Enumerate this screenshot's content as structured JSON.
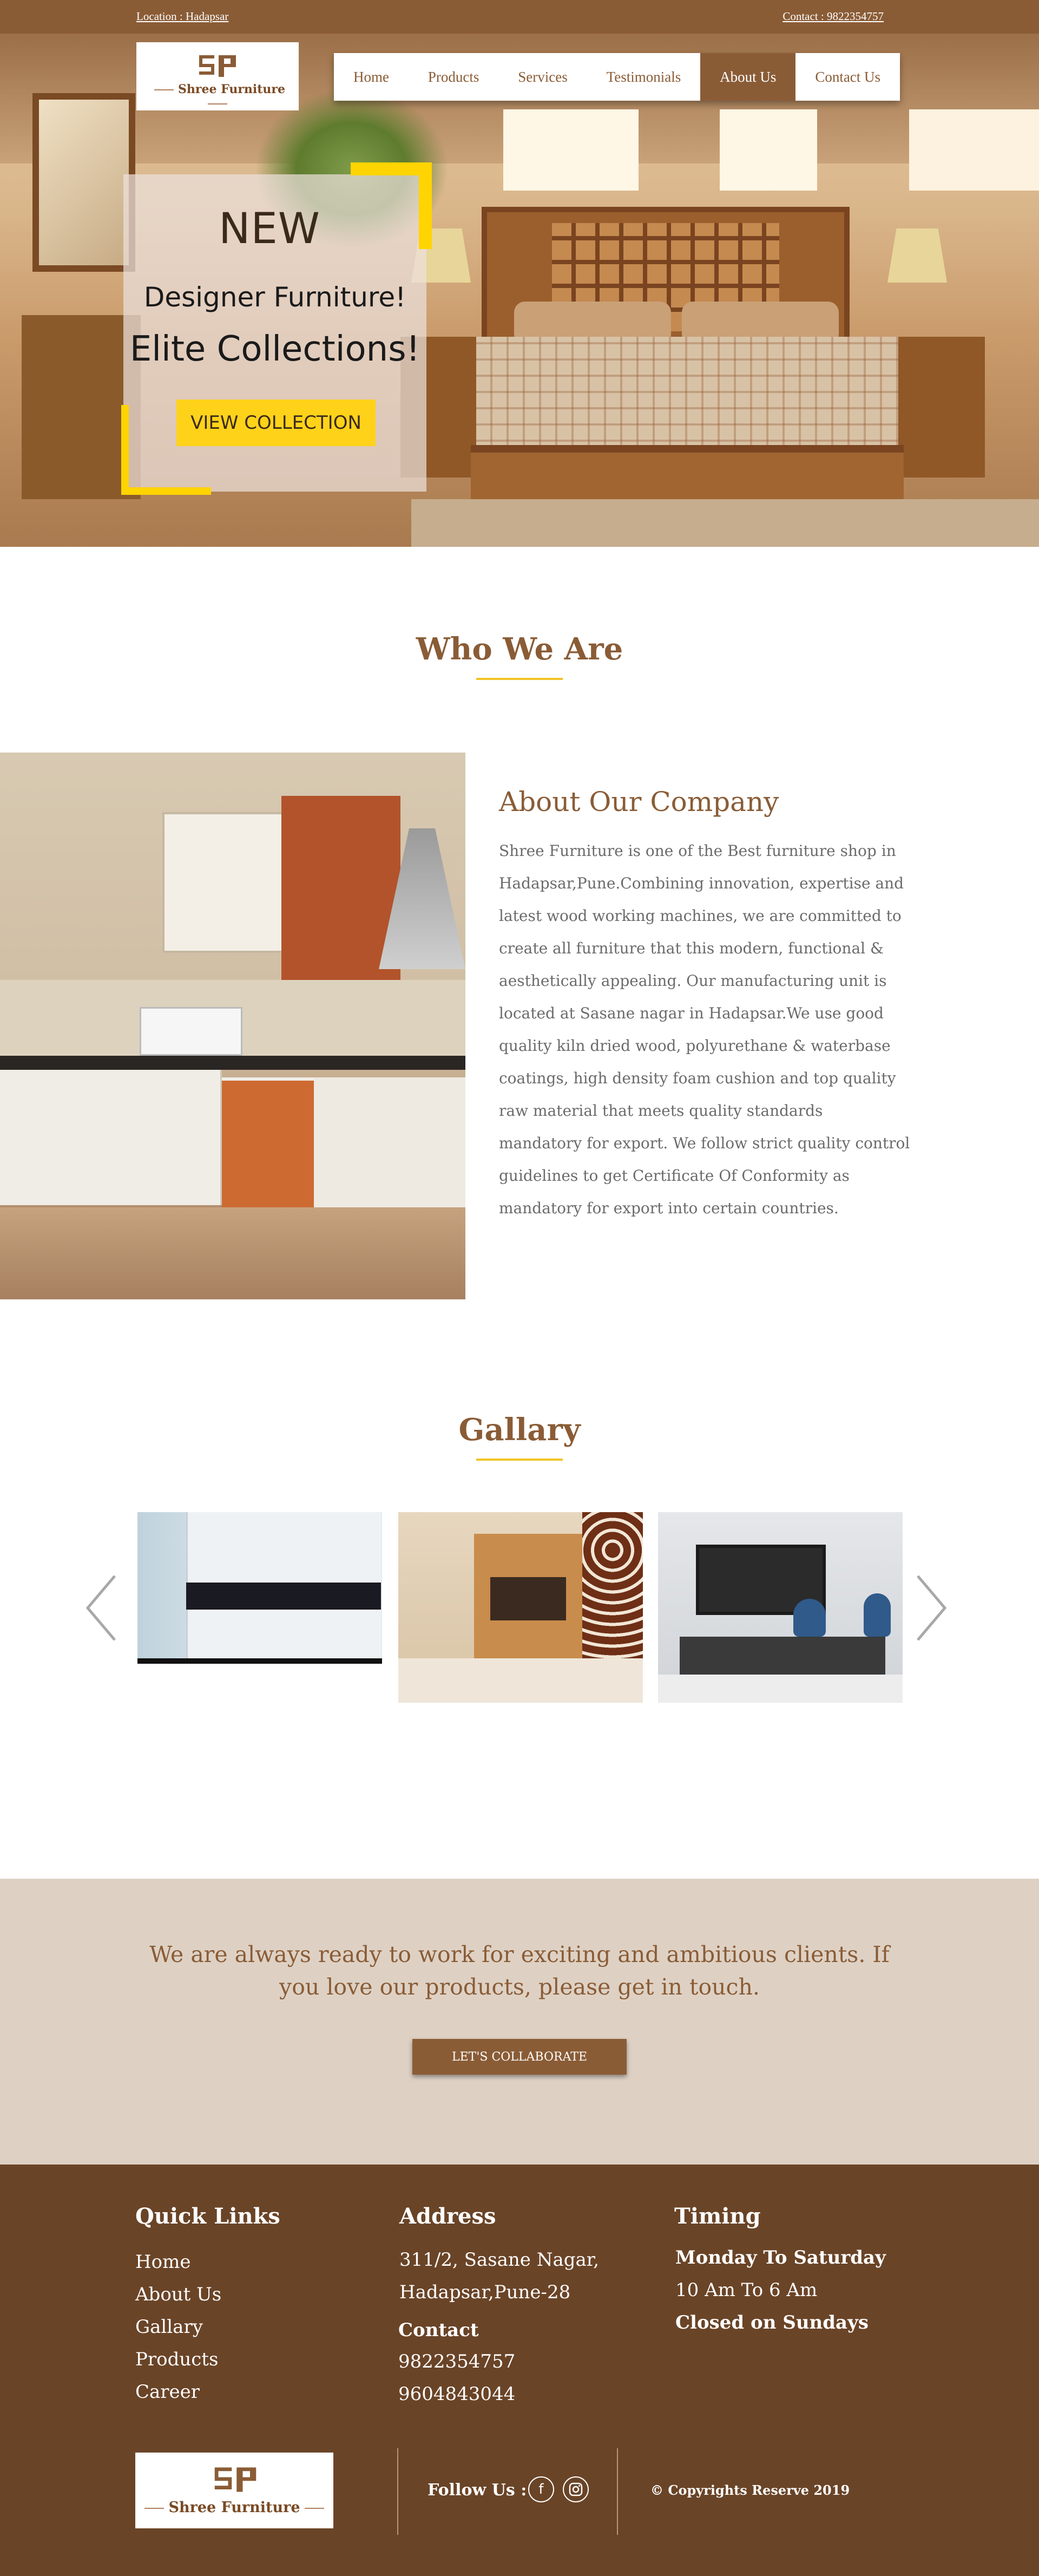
{
  "topbar": {
    "location": "Location : Hadapsar",
    "contact": "Contact : 9822354757"
  },
  "brand": {
    "name": "Shree Furniture",
    "mark": "SP"
  },
  "nav": {
    "items": [
      "Home",
      "Products",
      "Services",
      "Testimonials",
      "About Us",
      "Contact Us"
    ],
    "active": "About Us"
  },
  "hero": {
    "line1": "NEW",
    "line2": "Designer Furniture!",
    "line3": "Elite Collections!",
    "button": "VIEW COLLECTION"
  },
  "who": {
    "title": "Who We Are",
    "heading": "About Our Company",
    "paragraph": "Shree Furniture is one of the Best furniture shop in Hadapsar,Pune.Combining innovation, expertise and latest wood working machines, we are committed to create all furniture that this modern, functional & aesthetically appealing. Our manufacturing unit is located at Sasane nagar in Hadapsar.We use good quality kiln dried wood, polyurethane & waterbase coatings, high density foam cushion and top quality raw material that meets quality standards mandatory for export. We follow strict quality control guidelines to get Certificate Of Conformity as mandatory for export into certain countries."
  },
  "gallery": {
    "title": "Gallary",
    "prev_icon": "chevron-left-icon",
    "next_icon": "chevron-right-icon"
  },
  "collab": {
    "text": "We are always ready to work for exciting and ambitious clients. If you love our products, please get in touch.",
    "button": "LET'S COLLABORATE"
  },
  "footer": {
    "quick_links_title": "Quick Links",
    "quick_links": [
      "Home",
      "About Us",
      "Gallary",
      "Products",
      "Career"
    ],
    "address_title": "Address",
    "address_line1": "311/2, Sasane Nagar,",
    "address_line2": "Hadapsar,Pune-28",
    "contact_title": "Contact",
    "phone1": "9822354757",
    "phone2": "9604843044",
    "timing_title": "Timing",
    "timing_days": "Monday To Saturday",
    "timing_hours": "10 Am To 6 Am",
    "timing_closed": "Closed on Sundays",
    "follow": "Follow Us :",
    "social": [
      "facebook-icon",
      "instagram-icon"
    ],
    "copyright": "© Copyrights Reserve 2019"
  },
  "colors": {
    "brand_brown": "#8a5c36",
    "accent_yellow": "#ffd400",
    "footer_bg": "#6a4427",
    "collab_bg": "#ded1c4"
  }
}
